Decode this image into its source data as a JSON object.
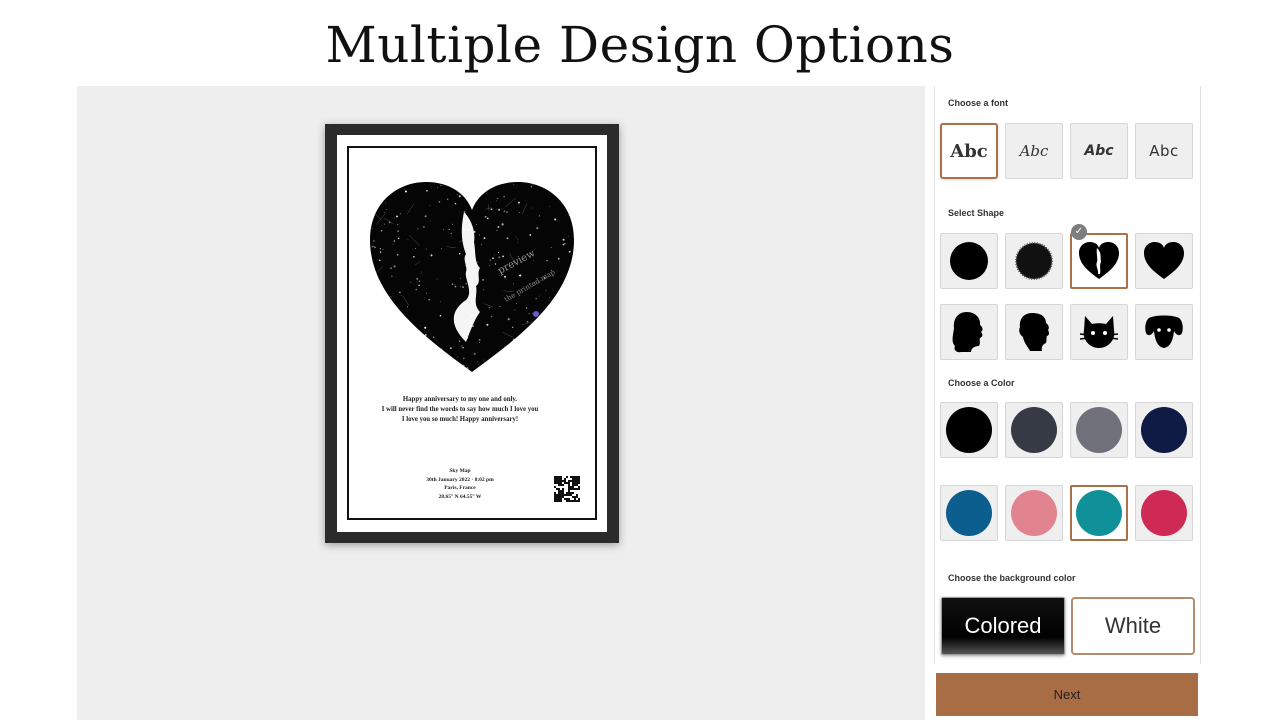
{
  "headline": "Multiple Design Options",
  "poster": {
    "message_lines": [
      "Happy anniversary to my one and only.",
      "I will never find the words to say how much I love you",
      "I love you so much! Happy anniversary!"
    ],
    "meta_lines": [
      "Sky Map",
      "30th January 2022 · 8:02 pm",
      "Paris, France",
      "28.65° N   64.55° W"
    ],
    "watermark_text": "preview   the printed map"
  },
  "panel": {
    "font_label": "Choose a font",
    "fonts": [
      {
        "label": "Abc",
        "selected": true
      },
      {
        "label": "Abc",
        "selected": false
      },
      {
        "label": "Abc",
        "selected": false
      },
      {
        "label": "Abc",
        "selected": false
      }
    ],
    "shape_label": "Select Shape",
    "shapes": [
      {
        "name": "circle",
        "selected": false
      },
      {
        "name": "circle-soft",
        "selected": false
      },
      {
        "name": "heart-couple",
        "selected": true
      },
      {
        "name": "heart",
        "selected": false
      },
      {
        "name": "woman-profile",
        "selected": false
      },
      {
        "name": "man-profile",
        "selected": false
      },
      {
        "name": "cat",
        "selected": false
      },
      {
        "name": "dog",
        "selected": false
      }
    ],
    "check_mark": "✓",
    "color_label": "Choose a Color",
    "colors": [
      {
        "hex": "#000000",
        "selected": false
      },
      {
        "hex": "#363a45",
        "selected": false
      },
      {
        "hex": "#70717a",
        "selected": false
      },
      {
        "hex": "#0f1a45",
        "selected": false
      },
      {
        "hex": "#0b5e8e",
        "selected": false
      },
      {
        "hex": "#e1848f",
        "selected": false
      },
      {
        "hex": "#10919a",
        "selected": true
      },
      {
        "hex": "#cf2955",
        "selected": false
      }
    ],
    "background_label": "Choose the background color",
    "background_options": [
      "Colored",
      "White"
    ]
  },
  "next_label": "Next",
  "accent_color": "#a86d45"
}
